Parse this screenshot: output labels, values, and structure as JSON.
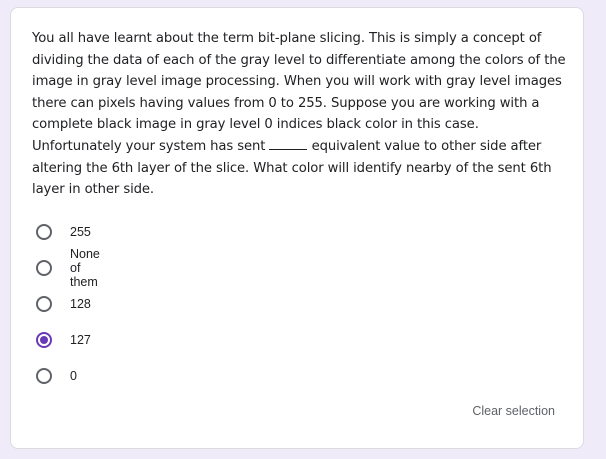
{
  "question": {
    "text_before_blank": "You all have learnt about the term bit-plane slicing. This is simply a concept of dividing the data of each of the gray level to differentiate among the colors of the image in gray level image processing. When you will work with gray level images there can pixels having values from 0 to 255. Suppose you are working with a complete black image in gray level 0 indices black color in this case. Unfortunately your system has sent ",
    "text_after_blank": " equivalent value to other side after altering the 6th layer of the slice. What color will identify nearby of the sent 6th layer in other side."
  },
  "options": [
    {
      "label": "255",
      "selected": false
    },
    {
      "label": "None of them",
      "selected": false
    },
    {
      "label": "128",
      "selected": false
    },
    {
      "label": "127",
      "selected": true
    },
    {
      "label": "0",
      "selected": false
    }
  ],
  "clear_selection_label": "Clear selection",
  "colors": {
    "accent": "#673ab7",
    "background": "#f0ebf8",
    "card": "#ffffff"
  }
}
